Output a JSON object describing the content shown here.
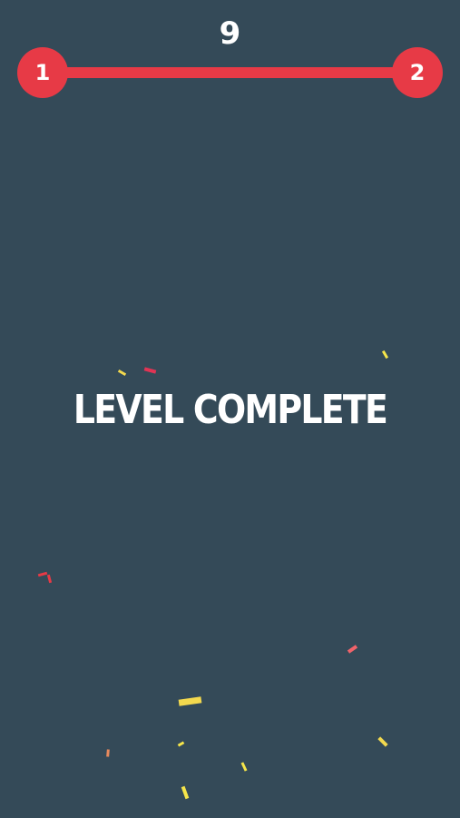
{
  "hud": {
    "score": "9",
    "current_level": "1",
    "next_level": "2",
    "level_progress": 1.0
  },
  "message": {
    "text": "LEVEL COMPLETE"
  },
  "colors": {
    "background": "#344a58",
    "accent": "#e73a46",
    "text": "#ffffff",
    "confetti": [
      "#f3d94e",
      "#e03454",
      "#f6e64a",
      "#e2b35b",
      "#f0636a",
      "#e88a5d"
    ]
  }
}
